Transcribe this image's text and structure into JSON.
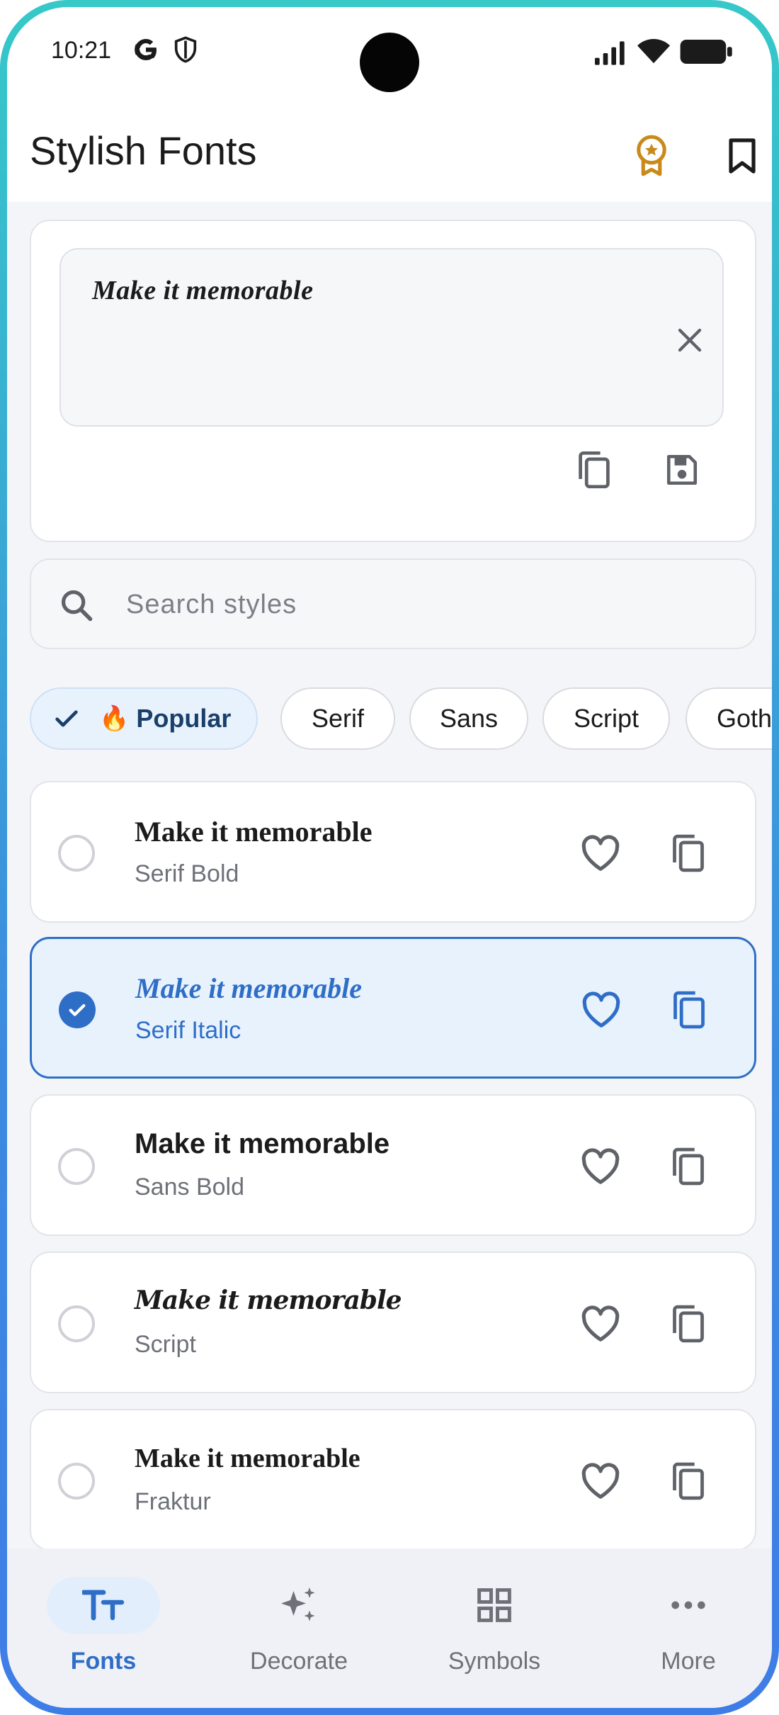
{
  "status_bar": {
    "time": "10:21"
  },
  "app_bar": {
    "title": "Stylish Fonts"
  },
  "editor": {
    "text": "Make it memorable"
  },
  "search": {
    "placeholder": "Search styles",
    "value": ""
  },
  "chips": [
    {
      "label": "Popular",
      "emoji": "🔥",
      "selected": true
    },
    {
      "label": "Serif",
      "selected": false
    },
    {
      "label": "Sans",
      "selected": false
    },
    {
      "label": "Script",
      "selected": false
    },
    {
      "label": "Gothic",
      "selected": false
    }
  ],
  "font_list": [
    {
      "sample": "Make it memorable",
      "name": "Serif Bold",
      "selected": false
    },
    {
      "sample": "Make it memorable",
      "name": "Serif Italic",
      "selected": true
    },
    {
      "sample": "Make it memorable",
      "name": "Sans Bold",
      "selected": false
    },
    {
      "sample": "Make it memorable",
      "name": "Script",
      "selected": false
    },
    {
      "sample": "Make it memorable",
      "name": "Fraktur",
      "selected": false
    }
  ],
  "bottom_nav": [
    {
      "label": "Fonts",
      "icon": "text-fonts-icon",
      "active": true
    },
    {
      "label": "Decorate",
      "icon": "sparkles-icon",
      "active": false
    },
    {
      "label": "Symbols",
      "icon": "grid-icon",
      "active": false
    },
    {
      "label": "More",
      "icon": "more-dots-icon",
      "active": false
    }
  ],
  "colors": {
    "accent": "#2e6ec7",
    "selected_bg": "#e8f2fd",
    "award": "#c98a1a",
    "frame_top": "#36c9c8",
    "frame_bottom": "#3f7de6"
  }
}
